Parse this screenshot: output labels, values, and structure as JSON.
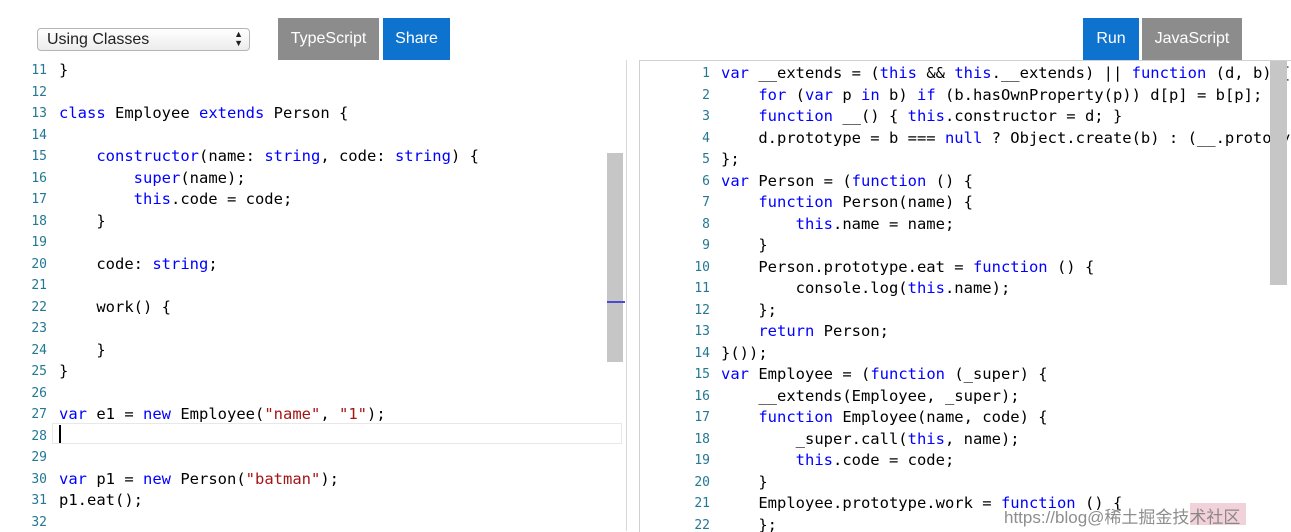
{
  "toolbar": {
    "example_select": "Using Classes",
    "typescript_label": "TypeScript",
    "share_label": "Share",
    "run_label": "Run",
    "javascript_label": "JavaScript"
  },
  "colors": {
    "blue_button": "#0e73cf",
    "gray_button": "#8c8c8c",
    "keyword": "#0000ff",
    "string": "#a31515",
    "line_number": "#237893"
  },
  "ts_editor": {
    "lines": [
      {
        "n": "11",
        "segs": [
          {
            "t": "}",
            "c": ""
          }
        ]
      },
      {
        "n": "12",
        "segs": []
      },
      {
        "n": "13",
        "segs": [
          {
            "t": "class",
            "c": "kw"
          },
          {
            "t": " Employee ",
            "c": ""
          },
          {
            "t": "extends",
            "c": "kw"
          },
          {
            "t": " Person {",
            "c": ""
          }
        ]
      },
      {
        "n": "14",
        "segs": []
      },
      {
        "n": "15",
        "segs": [
          {
            "t": "    ",
            "c": ""
          },
          {
            "t": "constructor",
            "c": "kw"
          },
          {
            "t": "(name: ",
            "c": ""
          },
          {
            "t": "string",
            "c": "kw"
          },
          {
            "t": ", code: ",
            "c": ""
          },
          {
            "t": "string",
            "c": "kw"
          },
          {
            "t": ") {",
            "c": ""
          }
        ]
      },
      {
        "n": "16",
        "segs": [
          {
            "t": "        ",
            "c": ""
          },
          {
            "t": "super",
            "c": "kw"
          },
          {
            "t": "(name);",
            "c": ""
          }
        ]
      },
      {
        "n": "17",
        "segs": [
          {
            "t": "        ",
            "c": ""
          },
          {
            "t": "this",
            "c": "kw"
          },
          {
            "t": ".code = code;",
            "c": ""
          }
        ]
      },
      {
        "n": "18",
        "segs": [
          {
            "t": "    }",
            "c": ""
          }
        ]
      },
      {
        "n": "19",
        "segs": []
      },
      {
        "n": "20",
        "segs": [
          {
            "t": "    code: ",
            "c": ""
          },
          {
            "t": "string",
            "c": "kw"
          },
          {
            "t": ";",
            "c": ""
          }
        ]
      },
      {
        "n": "21",
        "segs": []
      },
      {
        "n": "22",
        "segs": [
          {
            "t": "    work() {",
            "c": ""
          }
        ]
      },
      {
        "n": "23",
        "segs": []
      },
      {
        "n": "24",
        "segs": [
          {
            "t": "    }",
            "c": ""
          }
        ]
      },
      {
        "n": "25",
        "segs": [
          {
            "t": "}",
            "c": ""
          }
        ]
      },
      {
        "n": "26",
        "segs": []
      },
      {
        "n": "27",
        "segs": [
          {
            "t": "var",
            "c": "kw"
          },
          {
            "t": " e1 = ",
            "c": ""
          },
          {
            "t": "new",
            "c": "kw"
          },
          {
            "t": " Employee(",
            "c": ""
          },
          {
            "t": "\"name\"",
            "c": "str"
          },
          {
            "t": ", ",
            "c": ""
          },
          {
            "t": "\"1\"",
            "c": "str"
          },
          {
            "t": ");",
            "c": ""
          }
        ]
      },
      {
        "n": "28",
        "segs": []
      },
      {
        "n": "29",
        "segs": []
      },
      {
        "n": "30",
        "segs": [
          {
            "t": "var",
            "c": "kw"
          },
          {
            "t": " p1 = ",
            "c": ""
          },
          {
            "t": "new",
            "c": "kw"
          },
          {
            "t": " Person(",
            "c": ""
          },
          {
            "t": "\"batman\"",
            "c": "str"
          },
          {
            "t": ");",
            "c": ""
          }
        ]
      },
      {
        "n": "31",
        "segs": [
          {
            "t": "p1.eat();",
            "c": ""
          }
        ]
      },
      {
        "n": "32",
        "segs": []
      }
    ]
  },
  "js_output": {
    "lines": [
      {
        "n": "1",
        "segs": [
          {
            "t": "var",
            "c": "kw"
          },
          {
            "t": " __extends = (",
            "c": ""
          },
          {
            "t": "this",
            "c": "kw"
          },
          {
            "t": " && ",
            "c": ""
          },
          {
            "t": "this",
            "c": "kw"
          },
          {
            "t": ".__extends) || ",
            "c": ""
          },
          {
            "t": "function",
            "c": "kw"
          },
          {
            "t": " (d, b) {",
            "c": ""
          }
        ]
      },
      {
        "n": "2",
        "segs": [
          {
            "t": "    ",
            "c": ""
          },
          {
            "t": "for",
            "c": "kw"
          },
          {
            "t": " (",
            "c": ""
          },
          {
            "t": "var",
            "c": "kw"
          },
          {
            "t": " p ",
            "c": ""
          },
          {
            "t": "in",
            "c": "kw"
          },
          {
            "t": " b) ",
            "c": ""
          },
          {
            "t": "if",
            "c": "kw"
          },
          {
            "t": " (b.hasOwnProperty(p)) d[p] = b[p];",
            "c": ""
          }
        ]
      },
      {
        "n": "3",
        "segs": [
          {
            "t": "    ",
            "c": ""
          },
          {
            "t": "function",
            "c": "kw"
          },
          {
            "t": " __() { ",
            "c": ""
          },
          {
            "t": "this",
            "c": "kw"
          },
          {
            "t": ".constructor = d; }",
            "c": ""
          }
        ]
      },
      {
        "n": "4",
        "segs": [
          {
            "t": "    d.prototype = b === ",
            "c": ""
          },
          {
            "t": "null",
            "c": "kw"
          },
          {
            "t": " ? Object.create(b) : (__.prototype",
            "c": ""
          }
        ]
      },
      {
        "n": "5",
        "segs": [
          {
            "t": "};",
            "c": ""
          }
        ]
      },
      {
        "n": "6",
        "segs": [
          {
            "t": "var",
            "c": "kw"
          },
          {
            "t": " Person = (",
            "c": ""
          },
          {
            "t": "function",
            "c": "kw"
          },
          {
            "t": " () {",
            "c": ""
          }
        ]
      },
      {
        "n": "7",
        "segs": [
          {
            "t": "    ",
            "c": ""
          },
          {
            "t": "function",
            "c": "kw"
          },
          {
            "t": " Person(name) {",
            "c": ""
          }
        ]
      },
      {
        "n": "8",
        "segs": [
          {
            "t": "        ",
            "c": ""
          },
          {
            "t": "this",
            "c": "kw"
          },
          {
            "t": ".name = name;",
            "c": ""
          }
        ]
      },
      {
        "n": "9",
        "segs": [
          {
            "t": "    }",
            "c": ""
          }
        ]
      },
      {
        "n": "10",
        "segs": [
          {
            "t": "    Person.prototype.eat = ",
            "c": ""
          },
          {
            "t": "function",
            "c": "kw"
          },
          {
            "t": " () {",
            "c": ""
          }
        ]
      },
      {
        "n": "11",
        "segs": [
          {
            "t": "        console.log(",
            "c": ""
          },
          {
            "t": "this",
            "c": "kw"
          },
          {
            "t": ".name);",
            "c": ""
          }
        ]
      },
      {
        "n": "12",
        "segs": [
          {
            "t": "    };",
            "c": ""
          }
        ]
      },
      {
        "n": "13",
        "segs": [
          {
            "t": "    ",
            "c": ""
          },
          {
            "t": "return",
            "c": "kw"
          },
          {
            "t": " Person;",
            "c": ""
          }
        ]
      },
      {
        "n": "14",
        "segs": [
          {
            "t": "}());",
            "c": ""
          }
        ]
      },
      {
        "n": "15",
        "segs": [
          {
            "t": "var",
            "c": "kw"
          },
          {
            "t": " Employee = (",
            "c": ""
          },
          {
            "t": "function",
            "c": "kw"
          },
          {
            "t": " (_super) {",
            "c": ""
          }
        ]
      },
      {
        "n": "16",
        "segs": [
          {
            "t": "    __extends(Employee, _super);",
            "c": ""
          }
        ]
      },
      {
        "n": "17",
        "segs": [
          {
            "t": "    ",
            "c": ""
          },
          {
            "t": "function",
            "c": "kw"
          },
          {
            "t": " Employee(name, code) {",
            "c": ""
          }
        ]
      },
      {
        "n": "18",
        "segs": [
          {
            "t": "        _super.call(",
            "c": ""
          },
          {
            "t": "this",
            "c": "kw"
          },
          {
            "t": ", name);",
            "c": ""
          }
        ]
      },
      {
        "n": "19",
        "segs": [
          {
            "t": "        ",
            "c": ""
          },
          {
            "t": "this",
            "c": "kw"
          },
          {
            "t": ".code = code;",
            "c": ""
          }
        ]
      },
      {
        "n": "20",
        "segs": [
          {
            "t": "    }",
            "c": ""
          }
        ]
      },
      {
        "n": "21",
        "segs": [
          {
            "t": "    Employee.prototype.work = ",
            "c": ""
          },
          {
            "t": "function",
            "c": "kw"
          },
          {
            "t": " () {",
            "c": ""
          }
        ]
      },
      {
        "n": "22",
        "segs": [
          {
            "t": "    };",
            "c": ""
          }
        ]
      }
    ]
  },
  "watermark": "https://blog@稀土掘金技术社区"
}
